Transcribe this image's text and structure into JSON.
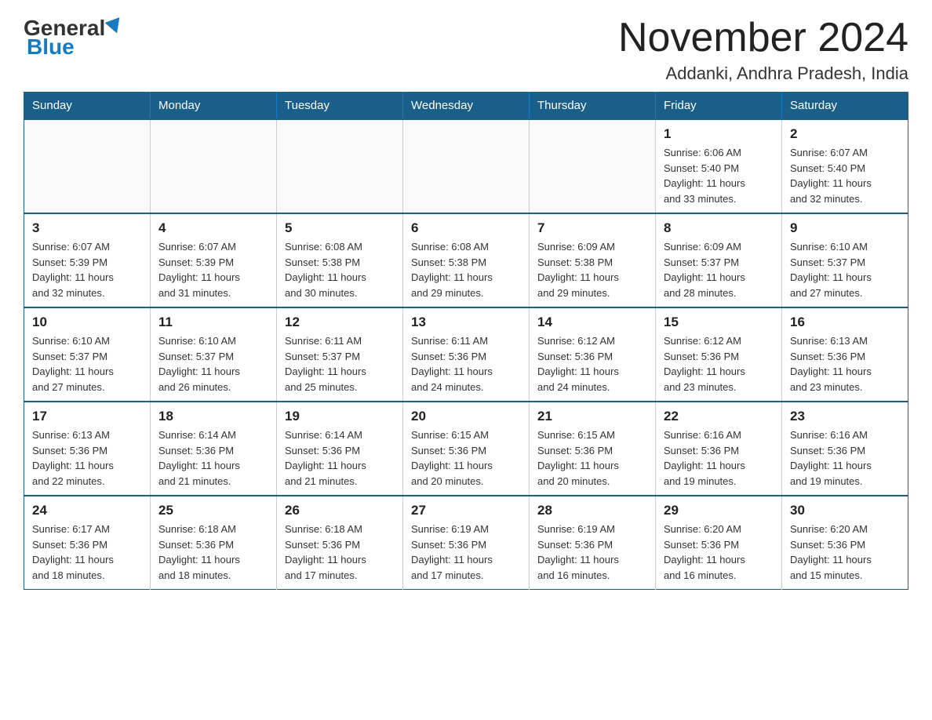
{
  "header": {
    "logo_general": "General",
    "logo_blue": "Blue",
    "month_title": "November 2024",
    "subtitle": "Addanki, Andhra Pradesh, India"
  },
  "weekdays": [
    "Sunday",
    "Monday",
    "Tuesday",
    "Wednesday",
    "Thursday",
    "Friday",
    "Saturday"
  ],
  "weeks": [
    [
      {
        "day": "",
        "info": ""
      },
      {
        "day": "",
        "info": ""
      },
      {
        "day": "",
        "info": ""
      },
      {
        "day": "",
        "info": ""
      },
      {
        "day": "",
        "info": ""
      },
      {
        "day": "1",
        "info": "Sunrise: 6:06 AM\nSunset: 5:40 PM\nDaylight: 11 hours\nand 33 minutes."
      },
      {
        "day": "2",
        "info": "Sunrise: 6:07 AM\nSunset: 5:40 PM\nDaylight: 11 hours\nand 32 minutes."
      }
    ],
    [
      {
        "day": "3",
        "info": "Sunrise: 6:07 AM\nSunset: 5:39 PM\nDaylight: 11 hours\nand 32 minutes."
      },
      {
        "day": "4",
        "info": "Sunrise: 6:07 AM\nSunset: 5:39 PM\nDaylight: 11 hours\nand 31 minutes."
      },
      {
        "day": "5",
        "info": "Sunrise: 6:08 AM\nSunset: 5:38 PM\nDaylight: 11 hours\nand 30 minutes."
      },
      {
        "day": "6",
        "info": "Sunrise: 6:08 AM\nSunset: 5:38 PM\nDaylight: 11 hours\nand 29 minutes."
      },
      {
        "day": "7",
        "info": "Sunrise: 6:09 AM\nSunset: 5:38 PM\nDaylight: 11 hours\nand 29 minutes."
      },
      {
        "day": "8",
        "info": "Sunrise: 6:09 AM\nSunset: 5:37 PM\nDaylight: 11 hours\nand 28 minutes."
      },
      {
        "day": "9",
        "info": "Sunrise: 6:10 AM\nSunset: 5:37 PM\nDaylight: 11 hours\nand 27 minutes."
      }
    ],
    [
      {
        "day": "10",
        "info": "Sunrise: 6:10 AM\nSunset: 5:37 PM\nDaylight: 11 hours\nand 27 minutes."
      },
      {
        "day": "11",
        "info": "Sunrise: 6:10 AM\nSunset: 5:37 PM\nDaylight: 11 hours\nand 26 minutes."
      },
      {
        "day": "12",
        "info": "Sunrise: 6:11 AM\nSunset: 5:37 PM\nDaylight: 11 hours\nand 25 minutes."
      },
      {
        "day": "13",
        "info": "Sunrise: 6:11 AM\nSunset: 5:36 PM\nDaylight: 11 hours\nand 24 minutes."
      },
      {
        "day": "14",
        "info": "Sunrise: 6:12 AM\nSunset: 5:36 PM\nDaylight: 11 hours\nand 24 minutes."
      },
      {
        "day": "15",
        "info": "Sunrise: 6:12 AM\nSunset: 5:36 PM\nDaylight: 11 hours\nand 23 minutes."
      },
      {
        "day": "16",
        "info": "Sunrise: 6:13 AM\nSunset: 5:36 PM\nDaylight: 11 hours\nand 23 minutes."
      }
    ],
    [
      {
        "day": "17",
        "info": "Sunrise: 6:13 AM\nSunset: 5:36 PM\nDaylight: 11 hours\nand 22 minutes."
      },
      {
        "day": "18",
        "info": "Sunrise: 6:14 AM\nSunset: 5:36 PM\nDaylight: 11 hours\nand 21 minutes."
      },
      {
        "day": "19",
        "info": "Sunrise: 6:14 AM\nSunset: 5:36 PM\nDaylight: 11 hours\nand 21 minutes."
      },
      {
        "day": "20",
        "info": "Sunrise: 6:15 AM\nSunset: 5:36 PM\nDaylight: 11 hours\nand 20 minutes."
      },
      {
        "day": "21",
        "info": "Sunrise: 6:15 AM\nSunset: 5:36 PM\nDaylight: 11 hours\nand 20 minutes."
      },
      {
        "day": "22",
        "info": "Sunrise: 6:16 AM\nSunset: 5:36 PM\nDaylight: 11 hours\nand 19 minutes."
      },
      {
        "day": "23",
        "info": "Sunrise: 6:16 AM\nSunset: 5:36 PM\nDaylight: 11 hours\nand 19 minutes."
      }
    ],
    [
      {
        "day": "24",
        "info": "Sunrise: 6:17 AM\nSunset: 5:36 PM\nDaylight: 11 hours\nand 18 minutes."
      },
      {
        "day": "25",
        "info": "Sunrise: 6:18 AM\nSunset: 5:36 PM\nDaylight: 11 hours\nand 18 minutes."
      },
      {
        "day": "26",
        "info": "Sunrise: 6:18 AM\nSunset: 5:36 PM\nDaylight: 11 hours\nand 17 minutes."
      },
      {
        "day": "27",
        "info": "Sunrise: 6:19 AM\nSunset: 5:36 PM\nDaylight: 11 hours\nand 17 minutes."
      },
      {
        "day": "28",
        "info": "Sunrise: 6:19 AM\nSunset: 5:36 PM\nDaylight: 11 hours\nand 16 minutes."
      },
      {
        "day": "29",
        "info": "Sunrise: 6:20 AM\nSunset: 5:36 PM\nDaylight: 11 hours\nand 16 minutes."
      },
      {
        "day": "30",
        "info": "Sunrise: 6:20 AM\nSunset: 5:36 PM\nDaylight: 11 hours\nand 15 minutes."
      }
    ]
  ]
}
